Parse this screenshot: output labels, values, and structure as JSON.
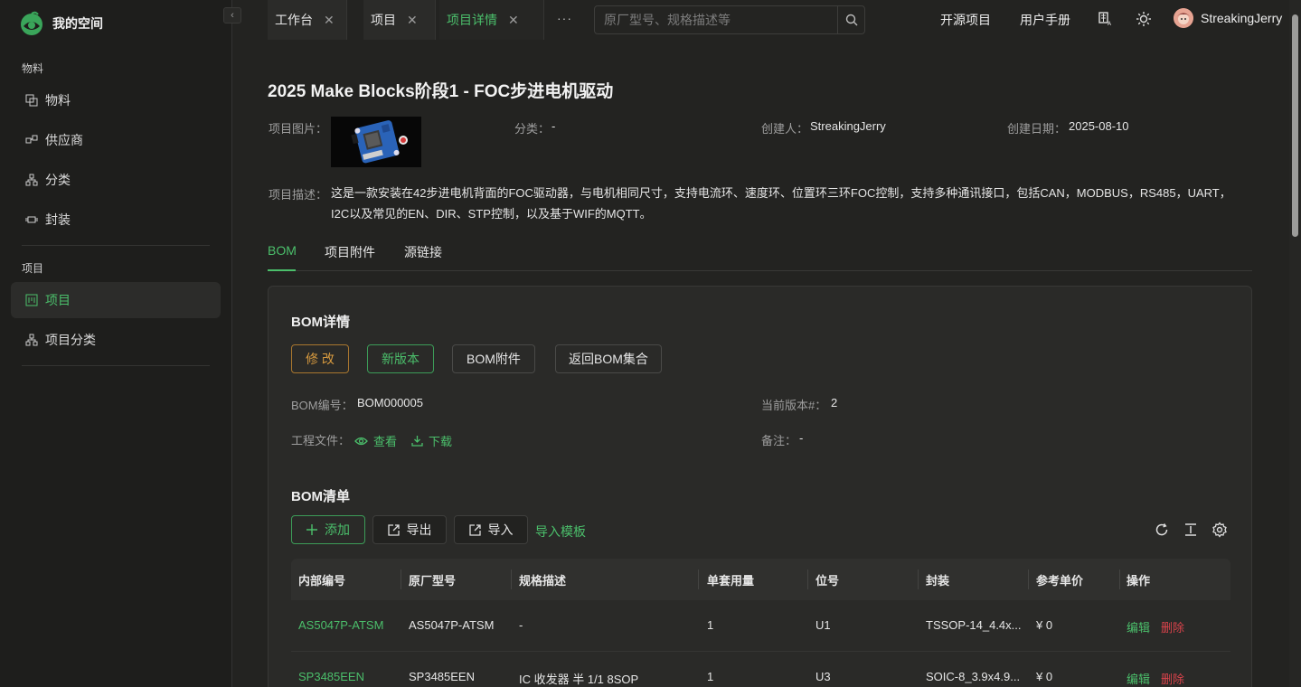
{
  "brand": {
    "name": "我的空间"
  },
  "sidebar": {
    "groups": [
      {
        "label": "物料"
      },
      {
        "label": "项目"
      }
    ],
    "items": [
      {
        "label": "物料",
        "icon": "material-icon"
      },
      {
        "label": "供应商",
        "icon": "supplier-icon"
      },
      {
        "label": "分类",
        "icon": "category-icon"
      },
      {
        "label": "封装",
        "icon": "package-icon"
      },
      {
        "label": "项目",
        "icon": "project-icon",
        "active": true
      },
      {
        "label": "项目分类",
        "icon": "project-category-icon"
      }
    ]
  },
  "topbar": {
    "tabs": [
      {
        "label": "工作台"
      },
      {
        "label": "项目"
      },
      {
        "label": "项目详情",
        "active": true
      }
    ],
    "more": "···",
    "search_placeholder": "原厂型号、规格描述等",
    "links": {
      "open_source": "开源项目",
      "manual": "用户手册"
    },
    "username": "StreakingJerry"
  },
  "project": {
    "title": "2025 Make Blocks阶段1 - FOC步进电机驱动",
    "image_label": "项目图片：",
    "category_label": "分类：",
    "category_value": "-",
    "creator_label": "创建人：",
    "creator_value": "StreakingJerry",
    "date_label": "创建日期：",
    "date_value": "2025-08-10",
    "desc_label": "项目描述：",
    "desc_value": "这是一款安装在42步进电机背面的FOC驱动器，与电机相同尺寸，支持电流环、速度环、位置环三环FOC控制，支持多种通讯接口，包括CAN，MODBUS，RS485，UART，I2C以及常见的EN、DIR、STP控制，以及基于WIF的MQTT。"
  },
  "page_tabs": [
    {
      "label": "BOM",
      "active": true
    },
    {
      "label": "项目附件"
    },
    {
      "label": "源链接"
    }
  ],
  "bom_detail": {
    "title": "BOM详情",
    "buttons": {
      "edit": "修 改",
      "new_version": "新版本",
      "attachments": "BOM附件",
      "back": "返回BOM集合"
    },
    "number_label": "BOM编号：",
    "number_value": "BOM000005",
    "version_label": "当前版本#：",
    "version_value": "2",
    "files_label": "工程文件：",
    "view_link": "查看",
    "download_link": "下载",
    "note_label": "备注：",
    "note_value": "-"
  },
  "bom_list": {
    "title": "BOM清单",
    "buttons": {
      "add": "添加",
      "export": "导出",
      "import": "导入",
      "template": "导入模板"
    },
    "columns": [
      "内部编号",
      "原厂型号",
      "规格描述",
      "单套用量",
      "位号",
      "封装",
      "参考单价",
      "操作"
    ],
    "rows": [
      {
        "internal": "AS5047P-ATSM",
        "mpn": "AS5047P-ATSM",
        "spec": "-",
        "qty": "1",
        "ref": "U1",
        "package": "TSSOP-14_4.4x...",
        "price": "¥ 0",
        "edit": "编辑",
        "delete": "删除"
      },
      {
        "internal": "SP3485EEN",
        "mpn": "SP3485EEN",
        "spec": "IC 收发器 半 1/1 8SOP",
        "qty": "1",
        "ref": "U3",
        "package": "SOIC-8_3.9x4.9...",
        "price": "¥ 0",
        "edit": "编辑",
        "delete": "删除"
      }
    ]
  },
  "colors": {
    "accent": "#4bbf6b",
    "warning": "#d79a3f",
    "danger": "#d9434b",
    "background": "#232321"
  }
}
